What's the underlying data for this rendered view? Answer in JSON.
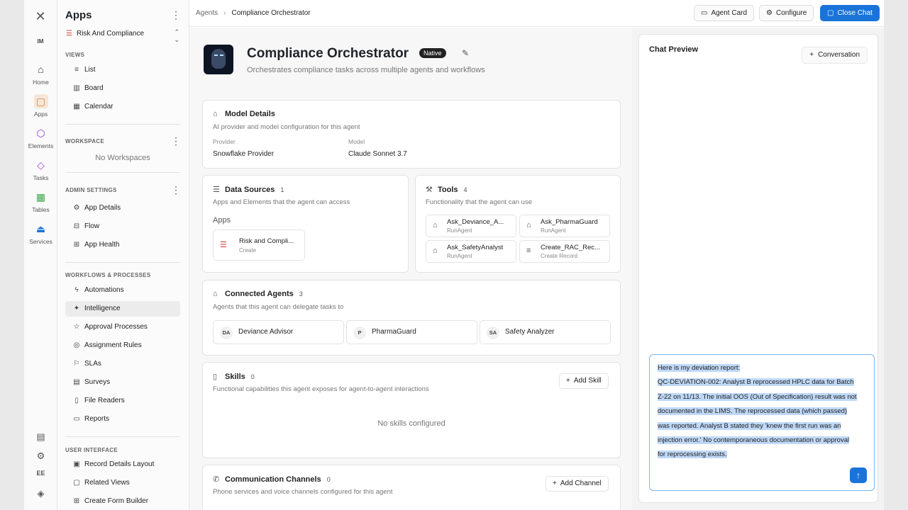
{
  "rail": {
    "close": "✕",
    "avatar": "IM",
    "items": [
      {
        "label": "Home",
        "icon": "home-icon",
        "glyph": "⌂",
        "color": "#333333"
      },
      {
        "label": "Apps",
        "icon": "apps-icon",
        "glyph": "▢",
        "color": "#e08a3c"
      },
      {
        "label": "Elements",
        "icon": "hexagon-icon",
        "glyph": "⬡",
        "color": "#8a3cd8"
      },
      {
        "label": "Tasks",
        "icon": "diamond-icon",
        "glyph": "◇",
        "color": "#b13cd8"
      },
      {
        "label": "Tables",
        "icon": "grid-icon",
        "glyph": "▦",
        "color": "#3aa84a"
      },
      {
        "label": "Services",
        "icon": "services-icon",
        "glyph": "⏏",
        "color": "#1a73d9"
      }
    ],
    "bottom": [
      "▤",
      "⚙",
      "EE",
      "◈"
    ]
  },
  "sidebar": {
    "title": "Apps",
    "app_selector": "Risk And Compliance",
    "views_heading": "VIEWS",
    "views": [
      "List",
      "Board",
      "Calendar"
    ],
    "workspace_heading": "WORKSPACE",
    "no_workspaces": "No Workspaces",
    "admin_heading": "ADMIN SETTINGS",
    "admin": [
      "App Details",
      "Flow",
      "App Health"
    ],
    "workflows_heading": "WORKFLOWS & PROCESSES",
    "workflows": [
      "Automations",
      "Intelligence",
      "Approval Processes",
      "Assignment Rules",
      "SLAs",
      "Surveys",
      "File Readers",
      "Reports"
    ],
    "ui_heading": "USER INTERFACE",
    "ui": [
      "Record Details Layout",
      "Related Views",
      "Create Form Builder"
    ]
  },
  "topbar": {
    "crumb_root": "Agents",
    "crumb_sep": "›",
    "crumb_current": "Compliance Orchestrator",
    "agent_card": "Agent Card",
    "configure": "Configure",
    "close_chat": "Close Chat"
  },
  "agent": {
    "name": "Compliance Orchestrator",
    "badge": "Native",
    "description": "Orchestrates compliance tasks across multiple agents and workflows"
  },
  "model": {
    "title": "Model Details",
    "subtitle": "AI provider and model configuration for this agent",
    "provider_label": "Provider",
    "provider": "Snowflake Provider",
    "model_label": "Model",
    "model": "Claude Sonnet 3.7"
  },
  "data_sources": {
    "title": "Data Sources",
    "count": "1",
    "subtitle": "Apps and Elements that the agent can access",
    "group": "Apps",
    "item_name": "Risk and Compli...",
    "item_sub": "Create"
  },
  "tools": {
    "title": "Tools",
    "count": "4",
    "subtitle": "Functionality that the agent can use",
    "items": [
      {
        "name": "Ask_Deviance_A...",
        "sub": "RunAgent"
      },
      {
        "name": "Ask_PharmaGuard",
        "sub": "RunAgent"
      },
      {
        "name": "Ask_SafetyAnalyst",
        "sub": "RunAgent"
      },
      {
        "name": "Create_RAC_Rec...",
        "sub": "Create Record"
      }
    ]
  },
  "connected": {
    "title": "Connected Agents",
    "count": "3",
    "subtitle": "Agents that this agent can delegate tasks to",
    "agents": [
      {
        "initials": "DA",
        "name": "Deviance Advisor"
      },
      {
        "initials": "P",
        "name": "PharmaGuard"
      },
      {
        "initials": "SA",
        "name": "Safety Analyzer"
      }
    ]
  },
  "skills": {
    "title": "Skills",
    "count": "0",
    "subtitle": "Functional capabilities this agent exposes for agent-to-agent interactions",
    "add": "Add Skill",
    "empty": "No skills configured"
  },
  "channels": {
    "title": "Communication Channels",
    "count": "0",
    "subtitle": "Phone services and voice channels configured for this agent",
    "add": "Add Channel"
  },
  "chat": {
    "title": "Chat Preview",
    "conversation": "Conversation",
    "message_lines": [
      "Here is my deviation report:",
      "QC-DEVIATION-002: Analyst B reprocessed HPLC data for Batch",
      "Z-22 on 11/13. The initial OOS (Out of Specification) result was not",
      "documented in the LIMS. The reprocessed data (which passed)",
      "was reported. Analyst B stated they 'knew the first run was an",
      "injection error.' No contemporaneous documentation or approval",
      "for reprocessing exists."
    ]
  },
  "colors": {
    "accent": "#1a73d9",
    "highlight": "#bfd8f7"
  }
}
